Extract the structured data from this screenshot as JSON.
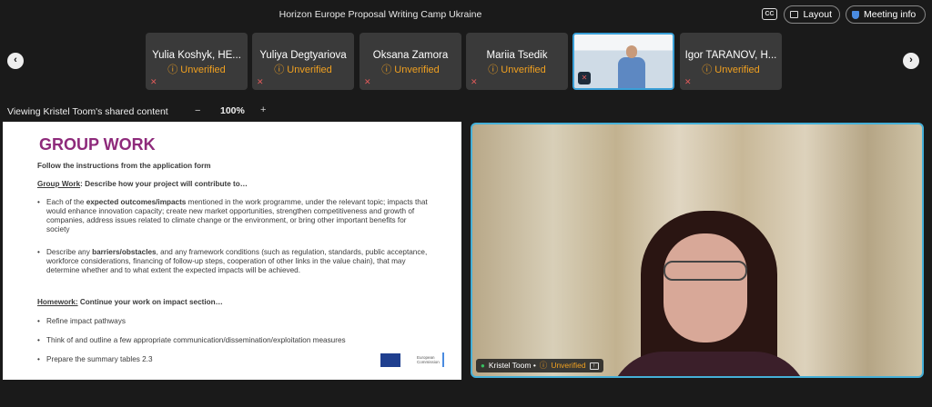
{
  "header": {
    "title": "Horizon Europe Proposal Writing Camp Ukraine",
    "cc_label": "CC",
    "layout_label": "Layout",
    "meeting_info_label": "Meeting info"
  },
  "participants": [
    {
      "name": "Yulia Koshyk, HE...",
      "status": "Unverified"
    },
    {
      "name": "Yuliya Degtyariova",
      "status": "Unverified"
    },
    {
      "name": "Oksana Zamora",
      "status": "Unverified"
    },
    {
      "name": "Mariia Tsedik",
      "status": "Unverified"
    },
    {
      "name": "Igor TARANOV, H...",
      "status": "Unverified"
    }
  ],
  "viewbar": {
    "label": "Viewing Kristel Toom's shared content",
    "zoom_minus": "−",
    "zoom": "100%",
    "zoom_plus": "+"
  },
  "slide": {
    "title": "GROUP WORK",
    "instruction": "Follow the instructions from the application form",
    "group_work_head": "Group Work",
    "group_work_text": ": Describe how your project will contribute to…",
    "b1_pre": "Each of the ",
    "b1_bold": "expected outcomes/impacts",
    "b1_post": " mentioned in the work programme, under the relevant topic; impacts that would enhance innovation capacity; create new market opportunities, strengthen competitiveness and growth of companies, address issues related to climate change or the environment, or bring other important benefits for society",
    "b2_pre": "Describe any ",
    "b2_bold": "barriers/obstacles",
    "b2_post": ", and any framework conditions (such as regulation, standards, public acceptance, workforce considerations, financing of follow-up steps, cooperation of other links in the value chain), that may determine whether and to what extent the expected impacts will be achieved.",
    "homework_head": "Homework:",
    "homework_text": " Continue your work on impact section…",
    "h1": "Refine impact pathways",
    "h2": "Think of and outline a few appropriate communication/dissemination/exploitation measures",
    "h3": "Prepare the summary tables 2.3",
    "logo_text1": "European",
    "logo_text2": "Commission"
  },
  "speaker": {
    "name": "Kristel Toom •",
    "status": "Unverified"
  },
  "colors": {
    "accent": "#45b0d8",
    "warning": "#f0a020",
    "slide_title": "#8e2a7b"
  },
  "icons": [
    "layout-icon",
    "shield-icon",
    "warning-circle-icon",
    "mic-muted-icon",
    "mic-icon",
    "pin-icon",
    "chevron-left-icon",
    "chevron-right-icon"
  ]
}
